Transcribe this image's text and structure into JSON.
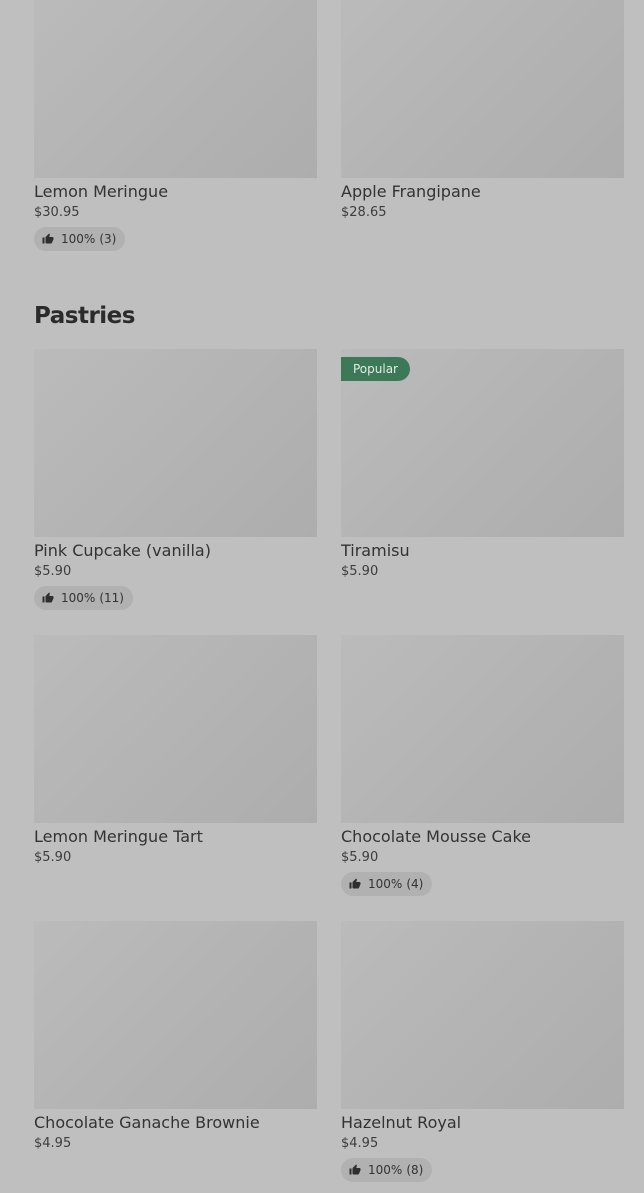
{
  "top_row": [
    {
      "name": "Lemon Meringue",
      "price": "$30.95",
      "rating": {
        "percent": "100%",
        "count": "(3)"
      }
    },
    {
      "name": "Apple Frangipane",
      "price": "$28.65"
    }
  ],
  "section": {
    "title": "Pastries"
  },
  "pastries": [
    {
      "name": "Pink Cupcake (vanilla)",
      "price": "$5.90",
      "rating": {
        "percent": "100%",
        "count": "(11)"
      }
    },
    {
      "name": "Tiramisu",
      "price": "$5.90",
      "badge": "Popular"
    },
    {
      "name": "Lemon Meringue Tart",
      "price": "$5.90"
    },
    {
      "name": "Chocolate Mousse Cake",
      "price": "$5.90",
      "rating": {
        "percent": "100%",
        "count": "(4)"
      }
    },
    {
      "name": "Chocolate Ganache Brownie",
      "price": "$4.95"
    },
    {
      "name": "Hazelnut Royal",
      "price": "$4.95",
      "rating": {
        "percent": "100%",
        "count": "(8)"
      }
    }
  ],
  "colors": {
    "background": "#bfbfbf",
    "badge": "#3c7a57",
    "rating_pill": "#b1b1b1"
  },
  "icons": {
    "rating": "thumbs-up-icon"
  }
}
